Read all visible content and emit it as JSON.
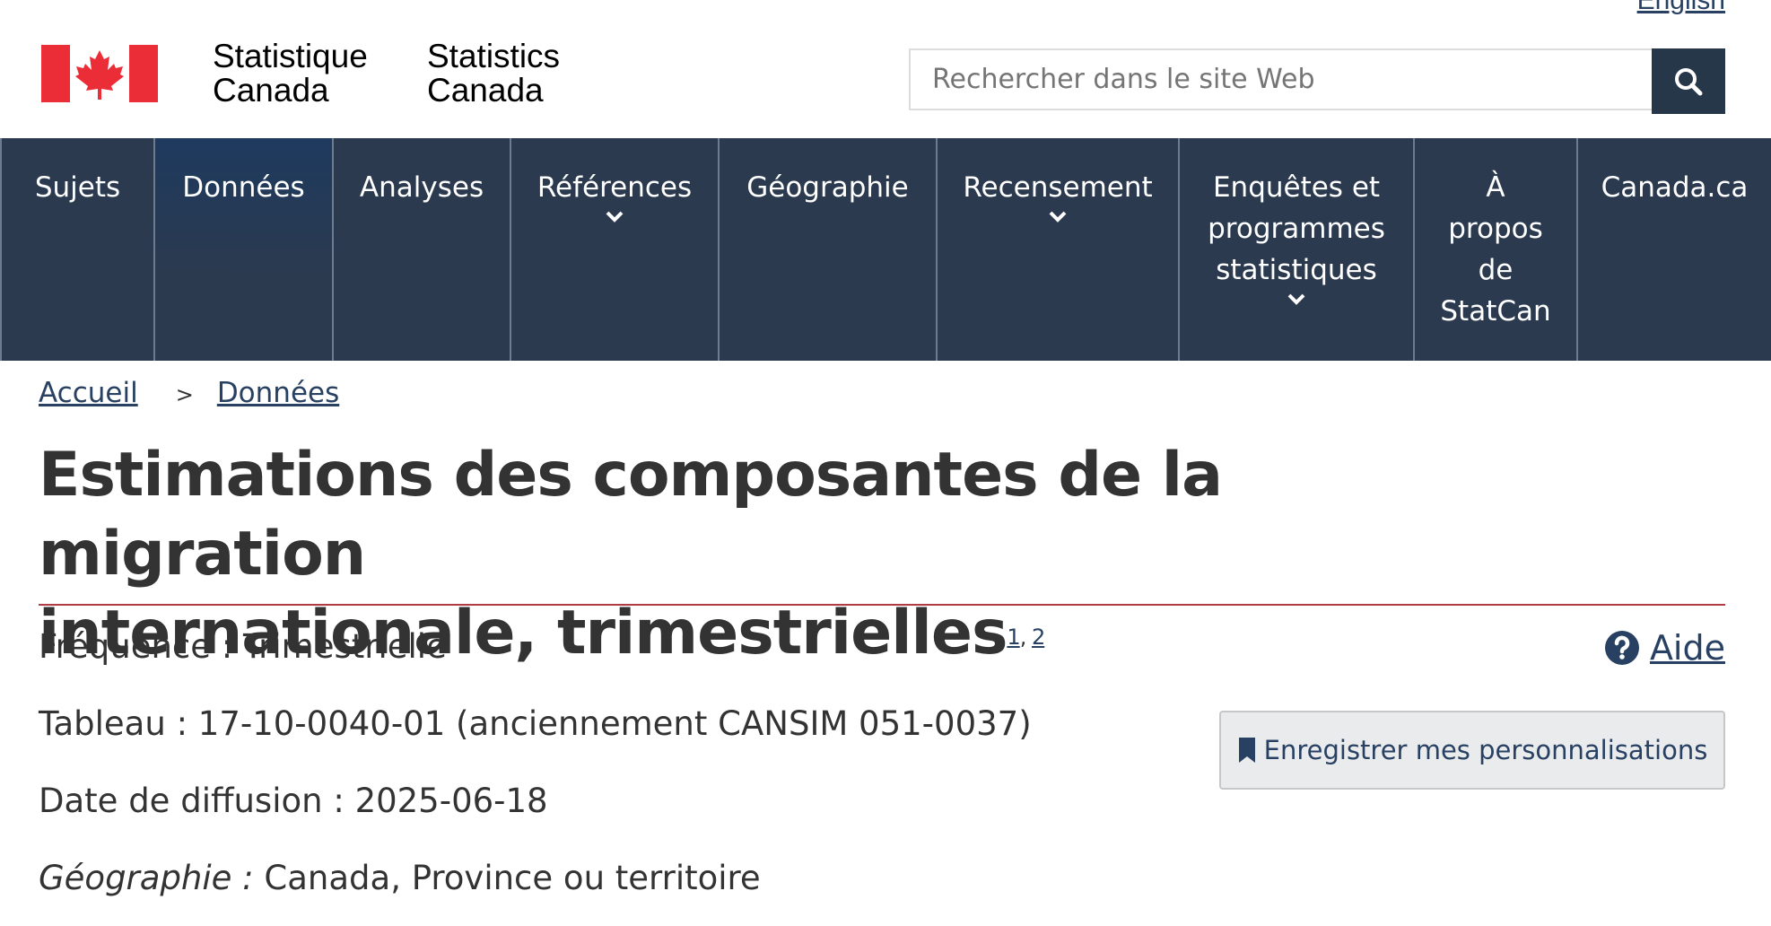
{
  "header": {
    "language_link": "English",
    "signature_fr_line1": "Statistique",
    "signature_fr_line2": "Canada",
    "signature_en_line1": "Statistics",
    "signature_en_line2": "Canada",
    "search_placeholder": "Rechercher dans le site Web",
    "search_button_icon": "search-icon",
    "brand_color": "#26374a",
    "flag_red": "#eb2d37"
  },
  "nav": {
    "items": [
      {
        "label": "Sujets",
        "has_dropdown": false
      },
      {
        "label": "Données",
        "has_dropdown": false,
        "active": true
      },
      {
        "label": "Analyses",
        "has_dropdown": false
      },
      {
        "label": "Références",
        "has_dropdown": true
      },
      {
        "label": "Géographie",
        "has_dropdown": false
      },
      {
        "label": "Recensement",
        "has_dropdown": true
      },
      {
        "label": "Enquêtes et programmes statistiques",
        "lines": [
          "Enquêtes et",
          "programmes",
          "statistiques"
        ],
        "has_dropdown": true
      },
      {
        "label": "À propos de StatCan",
        "lines": [
          "À",
          "propos",
          "de",
          "StatCan"
        ],
        "has_dropdown": false
      },
      {
        "label": "Canada.ca",
        "has_dropdown": false
      }
    ],
    "background": "#2b3a4f"
  },
  "breadcrumb": {
    "home": "Accueil",
    "separator": ">",
    "current": "Données"
  },
  "page": {
    "title_line1": "Estimations des composantes de la migration",
    "title_line2": "internationale, trimestrielles",
    "footnote_1": "1",
    "footnote_sep": ",",
    "footnote_2": "2",
    "accent_rule_color": "#af3c43"
  },
  "meta": {
    "frequency_label": "Fréquence :",
    "frequency_value": "Trimestrielle",
    "table_label": "Tableau :",
    "table_value": "17-10-0040-01 (anciennement CANSIM 051-0037)",
    "release_label": "Date de diffusion :",
    "release_value": "2025-06-18",
    "geography_label": "Géographie :",
    "geography_value": "Canada, Province ou territoire"
  },
  "actions": {
    "help_label": "Aide",
    "help_icon": "question-circle-icon",
    "save_label": "Enregistrer mes personnalisations",
    "save_icon": "bookmark-icon"
  }
}
